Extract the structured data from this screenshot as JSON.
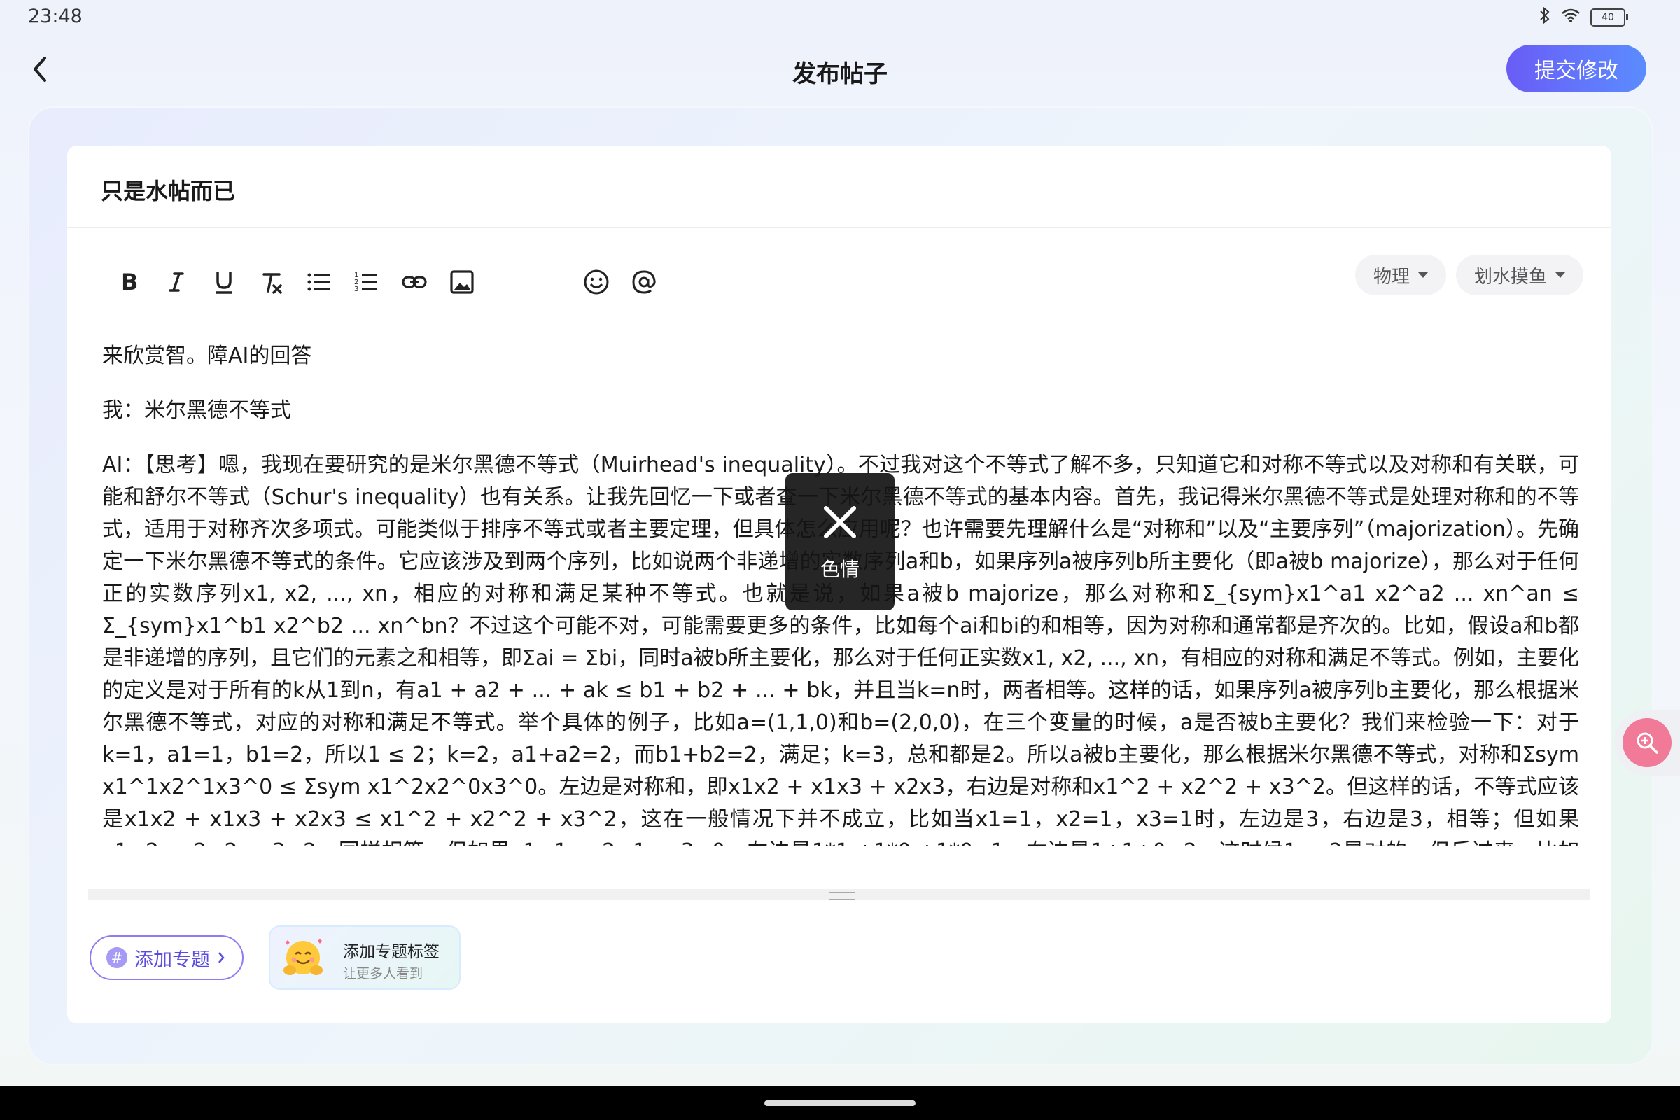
{
  "status_bar": {
    "time": "23:48",
    "battery": "40"
  },
  "header": {
    "title": "发布帖子",
    "submit_label": "提交修改"
  },
  "post": {
    "title": "只是水帖而已",
    "paragraphs": [
      "来欣赏智。障AI的回答",
      "我：米尔黑德不等式"
    ],
    "long_text": "AI：【思考】嗯，我现在要研究的是米尔黑德不等式（Muirhead's inequality）。不过我对这个不等式了解不多，只知道它和对称不等式以及对称和有关联，可能和舒尔不等式（Schur's inequality）也有关系。让我先回忆一下或者查一下米尔黑德不等式的基本内容。首先，我记得米尔黑德不等式是处理对称和的不等式，适用于对称齐次多项式。可能类似于排序不等式或者主要定理，但具体怎么应用呢？也许需要先理解什么是“对称和”以及“主要序列”（majorization）。先确定一下米尔黑德不等式的条件。它应该涉及到两个序列，比如说两个非递增的实数序列a和b，如果序列a被序列b所主要化（即a被b majorize），那么对于任何正的实数序列x1, x2, ..., xn，相应的对称和满足某种不等式。也就是说，如果a被b majorize，那么对称和Σ_{sym}x1^a1 x2^a2 ... xn^an ≤ Σ_{sym}x1^b1 x2^b2 ... xn^bn？不过这个可能不对，可能需要更多的条件，比如每个ai和bi的和相等，因为对称和通常都是齐次的。比如，假设a和b都是非递增的序列，且它们的元素之和相等，即Σai = Σbi，同时a被b所主要化，那么对于任何正实数x1, x2, ..., xn，有相应的对称和满足不等式。例如，主要化的定义是对于所有的k从1到n，有a1 + a2 + ... + ak ≤ b1 + b2 + ... + bk，并且当k=n时，两者相等。这样的话，如果序列a被序列b主要化，那么根据米尔黑德不等式，对应的对称和满足不等式。举个具体的例子，比如a=(1,1,0)和b=(2,0,0)，在三个变量的时候，a是否被b主要化？我们来检验一下：对于k=1，a1=1，b1=2，所以1 ≤ 2；k=2，a1+a2=2，而b1+b2=2，满足；k=3，总和都是2。所以a被b主要化，那么根据米尔黑德不等式，对称和Σsym x1^1x2^1x3^0 ≤ Σsym x1^2x2^0x3^0。左边是对称和，即x1x2 + x1x3 + x2x3，右边是对称和x1^2 + x2^2 + x3^2。但这样的话，不等式应该是x1x2 + x1x3 + x2x3 ≤ x1^2 + x2^2 + x3^2，这在一般情况下并不成立，比如当x1=1，x2=1，x3=1时，左边是3，右边是3，相等；但如果x1=2，x2=2，x3=2，同样相等。但如果x1=1，x2=1，x3=0，左边是1*1 +1*0 +1*0=1，右边是1+1+0=2，这时候1 ≤ 2是对的。但反过来，比如x1=3，x2=1，x3=1，左边是3*1 +3*1 +1*1=3+3+1=7，右边是9+1+1=11，也是成立的。看来这个例子是对的，但是原题中的情况是不是正确"
  },
  "toolbar": {
    "tools": [
      "bold-icon",
      "italic-icon",
      "underline-icon",
      "clear-format-icon",
      "bullet-list-icon",
      "numbered-list-icon",
      "link-icon",
      "image-icon",
      "emoji-icon",
      "mention-icon"
    ]
  },
  "categories": [
    {
      "label": "物理"
    },
    {
      "label": "划水摸鱼"
    }
  ],
  "topic": {
    "button_label": "添加专题",
    "hint_title": "添加专题标签",
    "hint_subtitle": "让更多人看到"
  },
  "overlay": {
    "label": "色情"
  },
  "colors": {
    "accent": "#6a5cf6",
    "accent2": "#5b8cff",
    "float_button": "#f07a98"
  }
}
